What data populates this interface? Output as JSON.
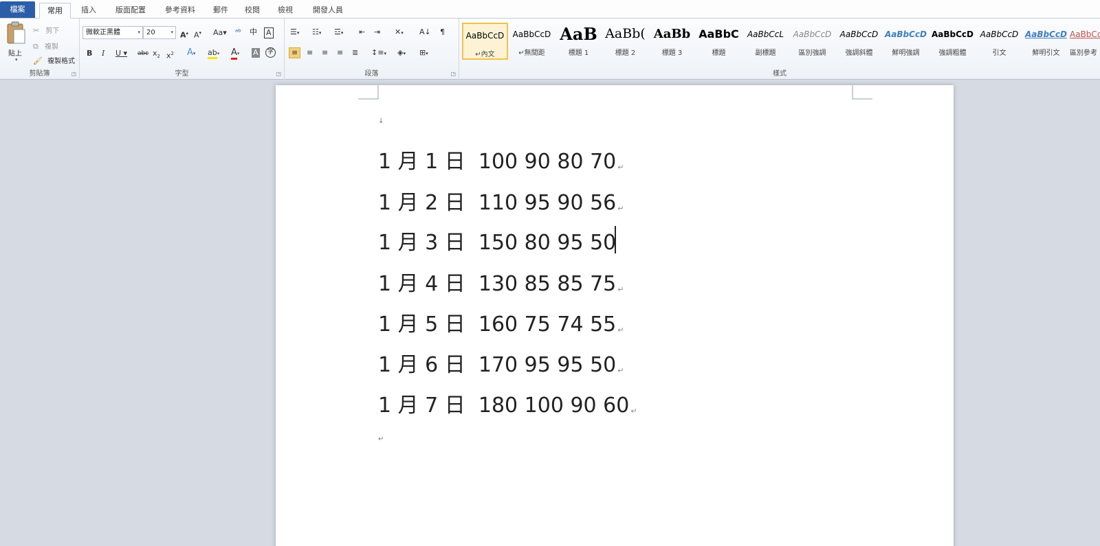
{
  "tabs": [
    {
      "id": "file",
      "label": "檔案"
    },
    {
      "id": "home",
      "label": "常用"
    },
    {
      "id": "insert",
      "label": "插入"
    },
    {
      "id": "layout",
      "label": "版面配置"
    },
    {
      "id": "references",
      "label": "參考資料"
    },
    {
      "id": "mailings",
      "label": "郵件"
    },
    {
      "id": "review",
      "label": "校閱"
    },
    {
      "id": "view",
      "label": "檢視"
    },
    {
      "id": "developer",
      "label": "開發人員"
    }
  ],
  "ribbon": {
    "clipboard": {
      "paste": "貼上",
      "cut": "剪下",
      "copy": "複製",
      "format_painter": "複製格式",
      "label": "剪貼簿"
    },
    "font": {
      "name": "微軟正黑體",
      "size": "20",
      "label": "字型"
    },
    "paragraph": {
      "label": "段落"
    },
    "styles": {
      "label": "樣式",
      "items": [
        {
          "sample": "AaBbCcD",
          "name": "↵內文"
        },
        {
          "sample": "AaBbCcD",
          "name": "↵無間距"
        },
        {
          "sample": "AaB",
          "name": "標題 1"
        },
        {
          "sample": "AaBb(",
          "name": "標題 2"
        },
        {
          "sample": "AaBb",
          "name": "標題 3"
        },
        {
          "sample": "AaBbC",
          "name": "標題"
        },
        {
          "sample": "AaBbCcL",
          "name": "副標題"
        },
        {
          "sample": "AaBbCcD",
          "name": "區別強調"
        },
        {
          "sample": "AaBbCcD",
          "name": "強調斜體"
        },
        {
          "sample": "AaBbCcD",
          "name": "鮮明強調"
        },
        {
          "sample": "AaBbCcD",
          "name": "強調粗體"
        },
        {
          "sample": "AaBbCcD",
          "name": "引文"
        },
        {
          "sample": "AaBbCcD",
          "name": "鮮明引文"
        },
        {
          "sample": "AaBbCc",
          "name": "區別參考"
        }
      ]
    }
  },
  "document": {
    "lines": [
      "1 月 1 日  100 90 80 70",
      "1 月 2 日  110 95 90 56",
      "1 月 3 日  150 80 95 50",
      "1 月 4 日  130 85 85 75",
      "1 月 5 日  160 75 74 55",
      "1 月 6 日  170 95 95 50",
      "1 月 7 日  180 100 90 60"
    ],
    "paragraph_mark": "↵"
  }
}
